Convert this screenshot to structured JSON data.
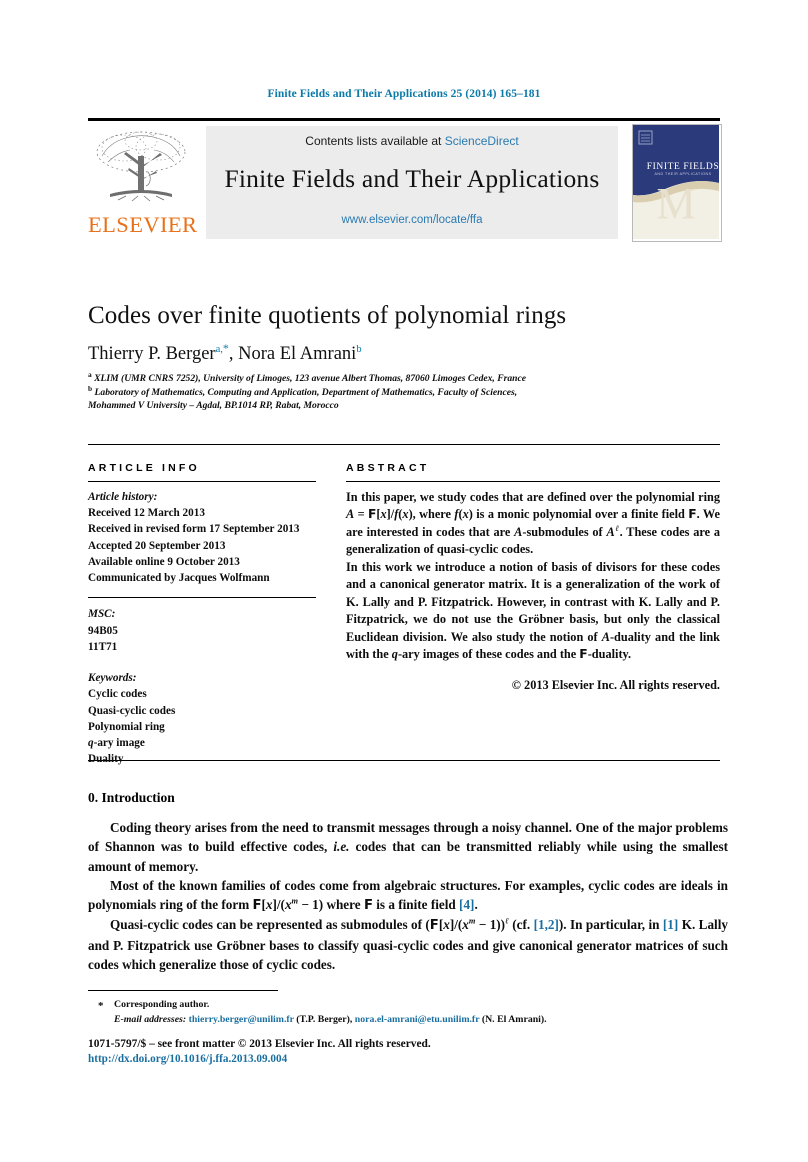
{
  "running_head": "Finite Fields and Their Applications 25 (2014) 165–181",
  "masthead": {
    "contents_prefix": "Contents lists available at ",
    "sciencedirect": "ScienceDirect",
    "journal_name": "Finite Fields and Their Applications",
    "journal_url": "www.elsevier.com/locate/ffa",
    "publisher": "ELSEVIER",
    "cover_title": "FINITE FIELDS",
    "cover_subtitle": "AND THEIR APPLICATIONS"
  },
  "article": {
    "title": "Codes over finite quotients of polynomial rings",
    "authors_1": "Thierry P. Berger",
    "authors_1_sup": "a,",
    "authors_1_star": "*",
    "authors_sep": ", ",
    "authors_2": "Nora El Amrani",
    "authors_2_sup": "b",
    "affiliation_a": "XLIM (UMR CNRS 7252), University of Limoges, 123 avenue Albert Thomas, 87060 Limoges Cedex, France",
    "affiliation_b_line1": "Laboratory of Mathematics, Computing and Application, Department of Mathematics, Faculty of Sciences,",
    "affiliation_b_line2": "Mohammed V University – Agdal, BP.1014 RP, Rabat, Morocco"
  },
  "info": {
    "heading": "ARTICLE INFO",
    "history_label": "Article history:",
    "history": [
      "Received 12 March 2013",
      "Received in revised form 17 September 2013",
      "Accepted 20 September 2013",
      "Available online 9 October 2013",
      "Communicated by Jacques Wolfmann"
    ],
    "msc_label": "MSC:",
    "msc": [
      "94B05",
      "11T71"
    ],
    "keywords_label": "Keywords:",
    "keywords": [
      "Cyclic codes",
      "Quasi-cyclic codes",
      "Polynomial ring",
      "q-ary image",
      "Duality"
    ]
  },
  "abstract": {
    "heading": "ABSTRACT",
    "paragraph_1": "In this paper, we study codes that are defined over the polynomial ring A = F[x]/f(x), where f(x) is a monic polynomial over a finite field F. We are interested in codes that are A-submodules of A^l. These codes are a generalization of quasi-cyclic codes.",
    "paragraph_2": "In this work we introduce a notion of basis of divisors for these codes and a canonical generator matrix. It is a generalization of the work of K. Lally and P. Fitzpatrick. However, in contrast with K. Lally and P. Fitzpatrick, we do not use the Gröbner basis, but only the classical Euclidean division. We also study the notion of A-duality and the link with the q-ary images of these codes and the F-duality.",
    "copyright": "© 2013 Elsevier Inc. All rights reserved."
  },
  "body": {
    "section_number": "0.",
    "section_title": "Introduction",
    "paragraph_1": "Coding theory arises from the need to transmit messages through a noisy channel. One of the major problems of Shannon was to build effective codes, i.e. codes that can be transmitted reliably while using the smallest amount of memory.",
    "paragraph_2": "Most of the known families of codes come from algebraic structures. For examples, cyclic codes are ideals in polynomials ring of the form F[x]/(x^m − 1) where F is a finite field [4].",
    "paragraph_3": "Quasi-cyclic codes can be represented as submodules of (F[x]/(x^m − 1))^l (cf. [1,2]). In particular, in [1] K. Lally and P. Fitzpatrick use Gröbner bases to classify quasi-cyclic codes and give canonical generator matrices of such codes which generalize those of cyclic codes.",
    "citations": {
      "c4": "[4]",
      "c12": "[1,2]",
      "c1": "[1]"
    }
  },
  "footer": {
    "corresponding_marker": "*",
    "corresponding": "Corresponding author.",
    "email_label": "E-mail addresses:",
    "email_1": "thierry.berger@unilim.fr",
    "email_1_who": "(T.P. Berger)",
    "email_2": "nora.el-amrani@etu.unilim.fr",
    "email_2_who": "(N. El Amrani)",
    "issn_line": "1071-5797/$ – see front matter © 2013 Elsevier Inc. All rights reserved.",
    "doi": "http://dx.doi.org/10.1016/j.ffa.2013.09.004"
  },
  "colors": {
    "link": "#1a6fa0",
    "header_blue": "#0b7aa8",
    "elsevier_orange": "#e8721c",
    "cover_navy": "#2b3a7a",
    "box_gray": "#ececec"
  }
}
